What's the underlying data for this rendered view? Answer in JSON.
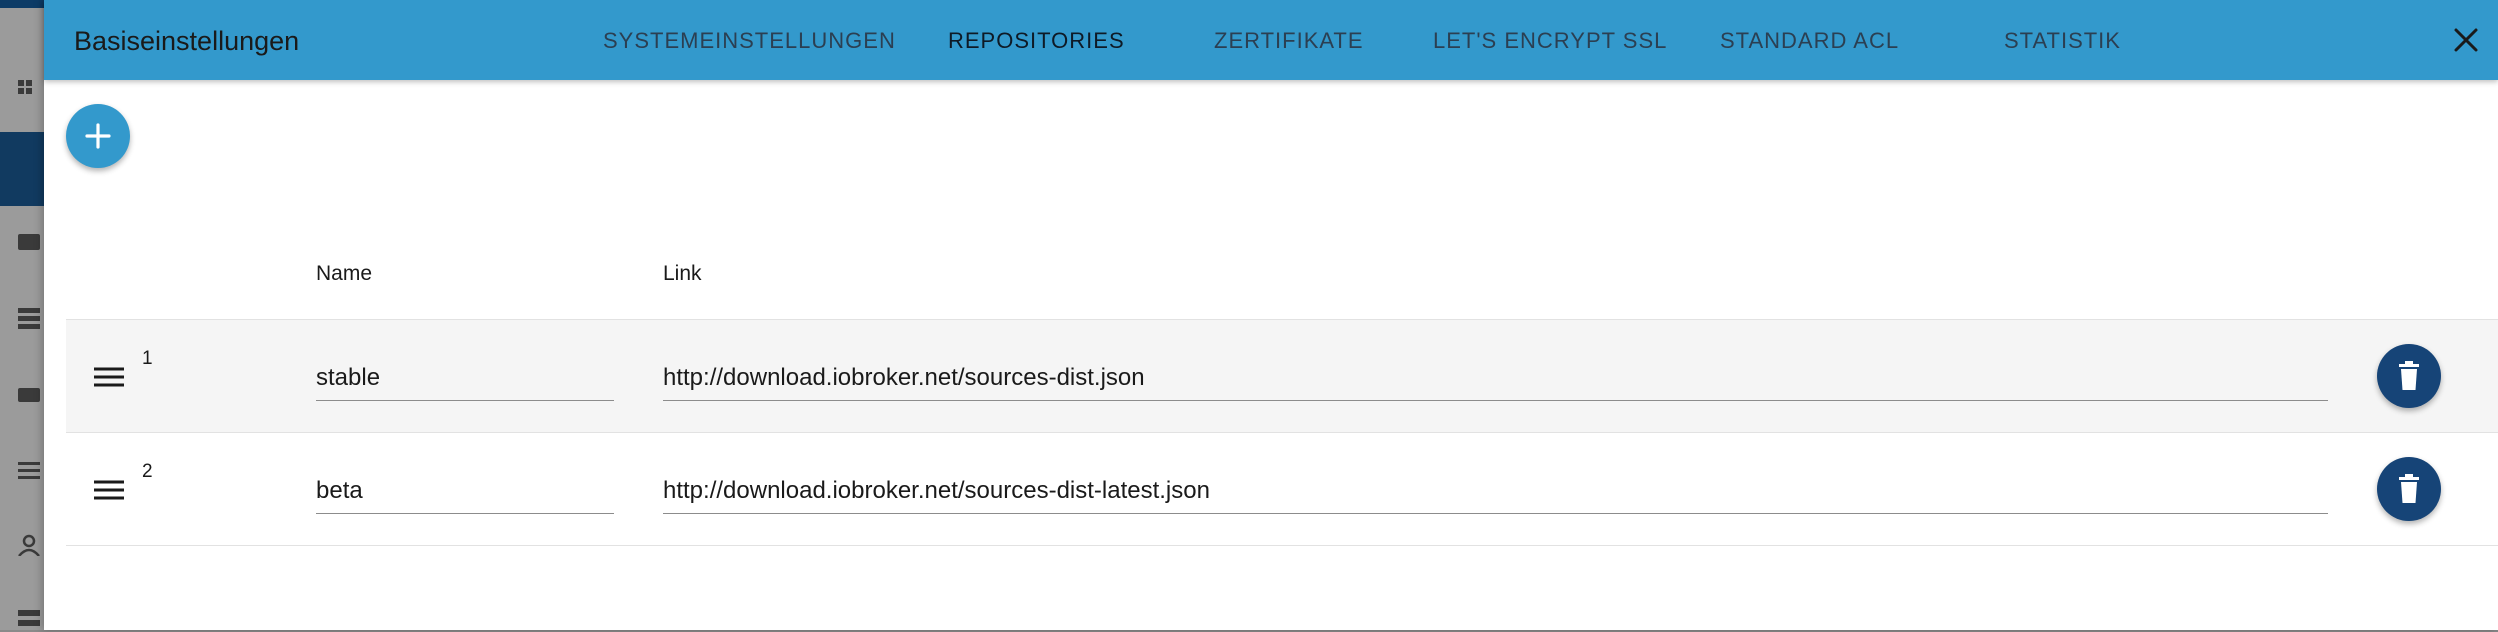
{
  "dialog": {
    "title": "Basiseinstellungen",
    "tabs": [
      {
        "label": "SYSTEMEINSTELLUNGEN",
        "active": false
      },
      {
        "label": "REPOSITORIES",
        "active": true
      },
      {
        "label": "ZERTIFIKATE",
        "active": false
      },
      {
        "label": "LET'S ENCRYPT SSL",
        "active": false
      },
      {
        "label": "STANDARD ACL",
        "active": false
      },
      {
        "label": "STATISTIK",
        "active": false
      }
    ],
    "close_icon": "close-icon"
  },
  "toolbar": {
    "add_icon": "plus-icon"
  },
  "table": {
    "headers": {
      "name": "Name",
      "link": "Link"
    },
    "rows": [
      {
        "number": "1",
        "name": "stable",
        "link": "http://download.iobroker.net/sources-dist.json"
      },
      {
        "number": "2",
        "name": "beta",
        "link": "http://download.iobroker.net/sources-dist-latest.json"
      }
    ]
  },
  "colors": {
    "appbar": "#3399cc",
    "accent": "#3399cc",
    "delete_button": "#164477",
    "row_striped": "#f5f5f5"
  }
}
